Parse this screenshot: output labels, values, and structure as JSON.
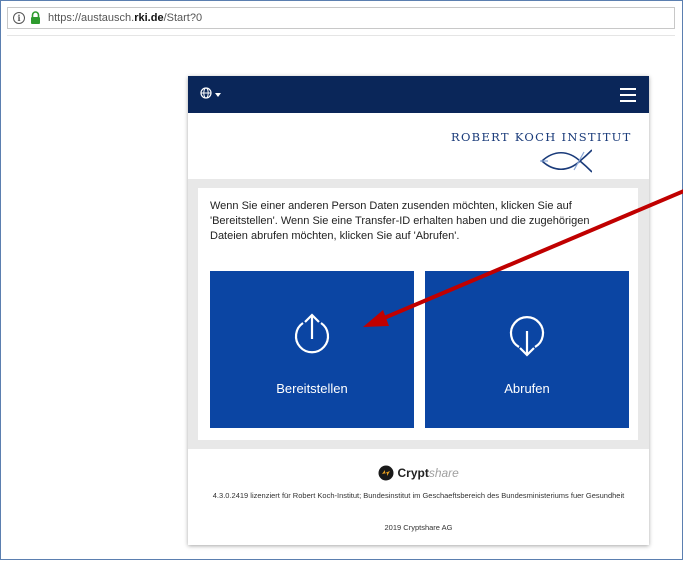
{
  "browser": {
    "url_scheme": "https://austausch.",
    "url_host": "rki.de",
    "url_path": "/Start?0"
  },
  "navbar": {
    "language_icon": "globe-icon",
    "menu_icon": "hamburger-menu-icon",
    "background_color": "#0a2659"
  },
  "logo": {
    "text": "ROBERT KOCH INSTITUT"
  },
  "main": {
    "intro_text": "Wenn Sie einer anderen Person Daten zusenden möchten, klicken Sie auf 'Bereitstellen'. Wenn Sie eine Transfer-ID erhalten haben und die zugehörigen Dateien abrufen möchten, klicken Sie auf 'Abrufen'.",
    "tiles": [
      {
        "label": "Bereitstellen",
        "icon": "upload-icon"
      },
      {
        "label": "Abrufen",
        "icon": "download-icon"
      }
    ],
    "tile_color": "#0b45a3"
  },
  "footer": {
    "brand_name": "Crypt",
    "brand_suffix": "share",
    "license_text": "4.3.0.2419 lizenziert für Robert Koch-Institut; Bundesinstitut im Geschaeftsbereich des Bundesministeriums fuer Gesundheit",
    "copyright": "2019 Cryptshare AG"
  },
  "annotation": {
    "arrow_color": "#c00000"
  }
}
